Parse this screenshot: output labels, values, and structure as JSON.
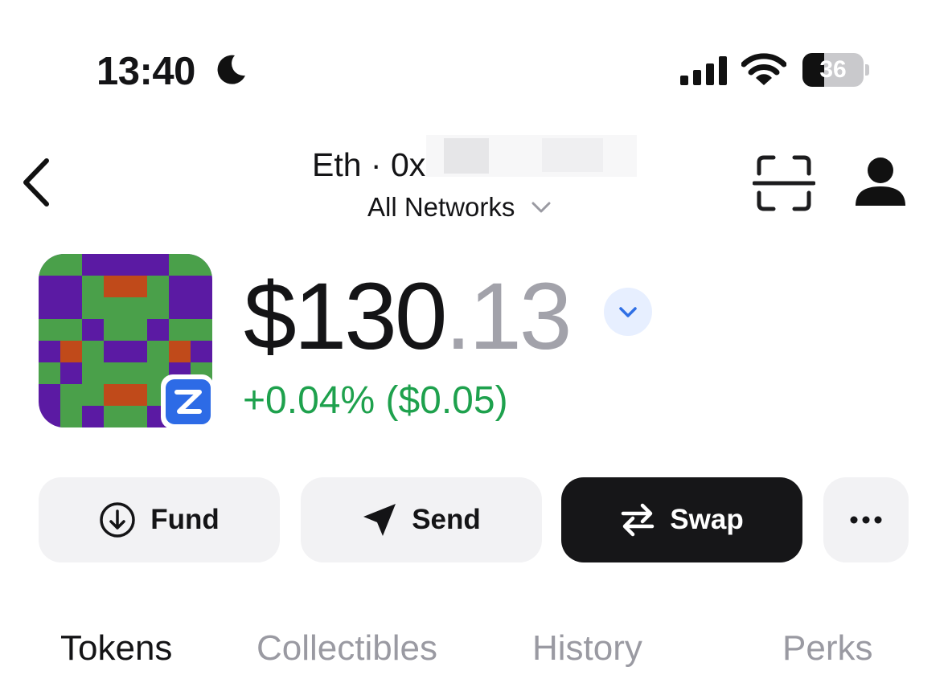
{
  "status_bar": {
    "time": "13:40",
    "battery_level": "36",
    "battery_fraction": 0.36,
    "icons": [
      "moon-icon",
      "cellular-signal-icon",
      "wifi-icon",
      "battery-icon"
    ]
  },
  "header": {
    "account_label": "Eth · 0x",
    "network_label": "All Networks",
    "icons": [
      "back-chevron-icon",
      "scan-qr-icon",
      "profile-icon",
      "chevron-down-icon"
    ]
  },
  "balance": {
    "whole": "$130",
    "cents": ".13",
    "change": "+0.04% ($0.05)",
    "colors": {
      "change": "#1ea14d",
      "cents": "#a2a2aa",
      "toggle": "#2f6fe5"
    }
  },
  "actions": {
    "fund_label": "Fund",
    "send_label": "Send",
    "swap_label": "Swap",
    "icons": [
      "arrow-down-circle-icon",
      "paper-plane-icon",
      "swap-arrows-icon",
      "more-dots-icon"
    ]
  },
  "tabs": [
    {
      "label": "Tokens",
      "active": true
    },
    {
      "label": "Collectibles",
      "active": false
    },
    {
      "label": "History",
      "active": false
    },
    {
      "label": "Perks",
      "active": false
    }
  ],
  "colors": {
    "accent": "#2d6be6",
    "swap_background": "#161618",
    "button_background": "#f2f2f4",
    "avatar_green": "#4aa04a",
    "avatar_purple": "#5b1aa3",
    "avatar_orange": "#c04a1a"
  }
}
